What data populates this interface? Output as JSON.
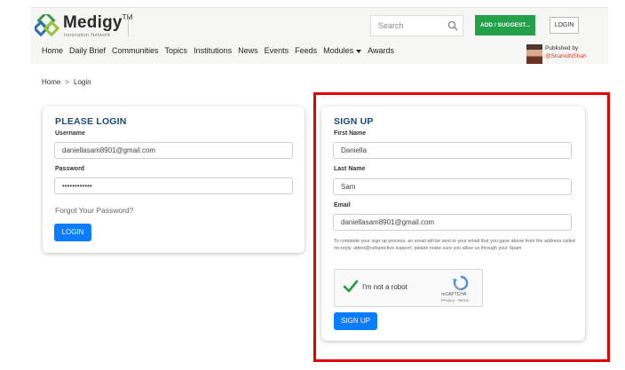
{
  "header": {
    "logo_name": "Medigy",
    "logo_tm": "TM",
    "logo_tagline": "Innovation Network",
    "search_placeholder": "Search",
    "add_button": "ADD / SUGGEST...",
    "login_button": "LOGIN",
    "nav_items": [
      "Home",
      "Daily Brief",
      "Communities",
      "Topics",
      "Institutions",
      "News",
      "Events",
      "Feeds",
      "Modules",
      "Awards"
    ],
    "published_by_label": "Published by",
    "published_by_handle": "@ShahidNShah"
  },
  "breadcrumb": {
    "home": "Home",
    "separator": ">",
    "current": "Login"
  },
  "login_card": {
    "title": "PLEASE LOGIN",
    "username_label": "Username",
    "username_value": "daniellasam8901@gmail.com",
    "password_label": "Password",
    "password_value": "••••••••••••",
    "forgot_link": "Forgot Your Password?",
    "submit_label": "LOGIN"
  },
  "signup_card": {
    "title": "SIGN UP",
    "first_name_label": "First Name",
    "first_name_value": "Daniella",
    "last_name_label": "Last Name",
    "last_name_value": "Sam",
    "email_label": "Email",
    "email_value": "daniellasam8901@gmail.com",
    "notice": "To complete your sign up process, an email will be sent to your email that you gave above from the address called no-reply. attest@netspective.support, please make sure you allow us through your Spam",
    "captcha_text": "I'm not a robot",
    "captcha_brand": "reCAPTCHA",
    "captcha_links": "Privacy - Terms",
    "submit_label": "SIGN UP"
  },
  "colors": {
    "brand_green": "#24a148",
    "primary_blue": "#0a7cff",
    "title_blue": "#1a4a7a",
    "highlight_red": "#e30000",
    "handle_red": "#d13f2c"
  }
}
